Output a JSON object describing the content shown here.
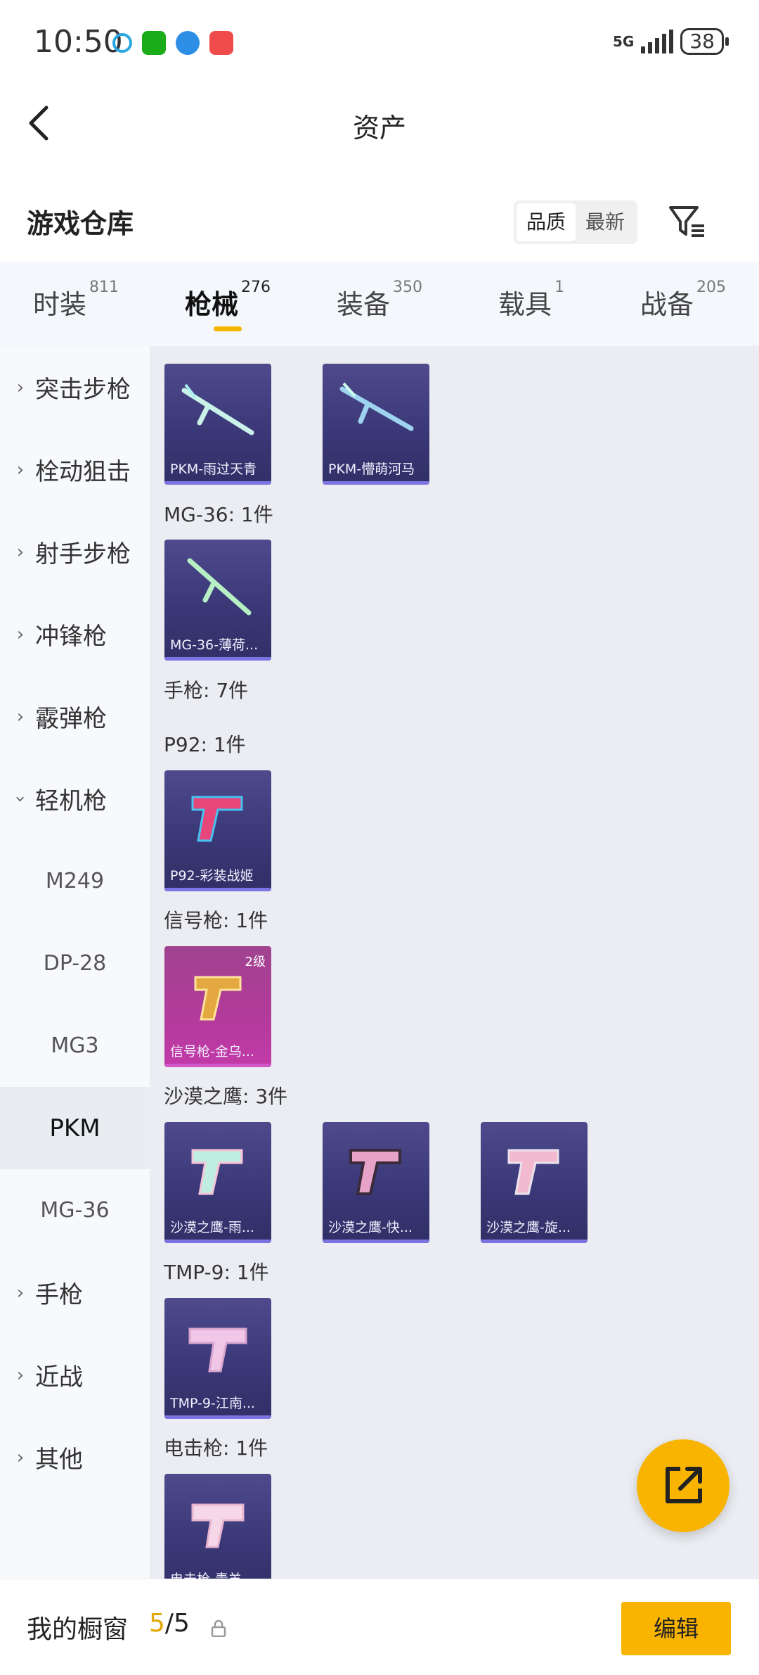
{
  "status_bar": {
    "time": "10:50",
    "network": "5G",
    "battery": "38"
  },
  "header": {
    "title": "资产"
  },
  "warehouse": {
    "label": "游戏仓库",
    "sort_options": [
      "品质",
      "最新"
    ],
    "sort_selected": "品质"
  },
  "tabs": [
    {
      "label": "时装",
      "count": "811"
    },
    {
      "label": "枪械",
      "count": "276"
    },
    {
      "label": "装备",
      "count": "350"
    },
    {
      "label": "载具",
      "count": "1"
    },
    {
      "label": "战备",
      "count": "205"
    }
  ],
  "active_tab": "枪械",
  "sidebar": {
    "items": [
      "突击步枪",
      "栓动狙击",
      "射手步枪",
      "冲锋枪",
      "霰弹枪",
      "轻机枪",
      "手枪",
      "近战",
      "其他"
    ],
    "expanded": "轻机枪",
    "sub_items": [
      "M249",
      "DP-28",
      "MG3",
      "PKM",
      "MG-36"
    ],
    "selected_sub": "PKM"
  },
  "content": {
    "pkm_items": [
      "PKM-雨过天青",
      "PKM-懵萌河马"
    ],
    "mg36_label": "MG-36: 1件",
    "mg36_items": [
      "MG-36-薄荷..."
    ],
    "pistol_label": "手枪: 7件",
    "p92_label": "P92: 1件",
    "p92_items": [
      "P92-彩装战姬"
    ],
    "flare_label": "信号枪: 1件",
    "flare_items": [
      "信号枪-金乌..."
    ],
    "flare_level": "2级",
    "deagle_label": "沙漠之鹰: 3件",
    "deagle_items": [
      "沙漠之鹰-雨...",
      "沙漠之鹰-快...",
      "沙漠之鹰-旋..."
    ],
    "tmp_label": "TMP-9: 1件",
    "tmp_items": [
      "TMP-9-江南..."
    ],
    "stun_label": "电击枪: 1件",
    "stun_items": [
      "电击枪-青羊..."
    ]
  },
  "bottom": {
    "label": "我的橱窗",
    "count_current": "5",
    "count_total": "/5",
    "edit_label": "编辑"
  },
  "colors": {
    "accent": "#f8b400",
    "card_purple": "#3b3878",
    "card_pink": "#b33a9b"
  }
}
